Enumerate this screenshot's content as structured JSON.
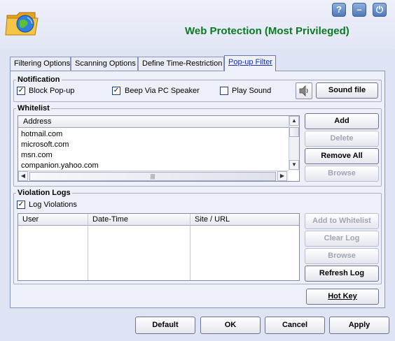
{
  "app": {
    "title": "Web Protection (Most Privileged)",
    "window_buttons": {
      "help": "?",
      "minimize": "–",
      "power": "⏻"
    }
  },
  "tabs": [
    {
      "label": "Filtering Options",
      "active": false
    },
    {
      "label": "Scanning Options",
      "active": false
    },
    {
      "label": "Define Time-Restriction",
      "active": false
    },
    {
      "label": "Pop-up Filter",
      "active": true
    }
  ],
  "notification": {
    "group_label": "Notification",
    "block_popup": {
      "label": "Block Pop-up",
      "checked": true
    },
    "beep": {
      "label": "Beep Via PC Speaker",
      "checked": true
    },
    "play_sound": {
      "label": "Play Sound",
      "checked": false
    },
    "speaker_icon": "speaker-icon",
    "sound_file_button": "Sound file"
  },
  "whitelist": {
    "group_label": "Whitelist",
    "column_header": "Address",
    "rows": [
      "hotmail.com",
      "microsoft.com",
      "msn.com",
      "companion.yahoo.com"
    ],
    "buttons": {
      "add": "Add",
      "delete": "Delete",
      "remove_all": "Remove All",
      "browse": "Browse"
    }
  },
  "violation_logs": {
    "group_label": "Violation Logs",
    "log_violations": {
      "label": "Log Violations",
      "checked": true
    },
    "columns": [
      "User",
      "Date-Time",
      "Site / URL"
    ],
    "buttons": {
      "add_to_whitelist": "Add to Whitelist",
      "clear_log": "Clear Log",
      "browse": "Browse",
      "refresh_log": "Refresh Log"
    }
  },
  "hotkey_button": "Hot Key",
  "footer": {
    "default": "Default",
    "ok": "OK",
    "cancel": "Cancel",
    "apply": "Apply"
  },
  "colors": {
    "title": "#0a7a22",
    "active_tab": "#1a2fb5",
    "background": "#dfe4f4"
  }
}
